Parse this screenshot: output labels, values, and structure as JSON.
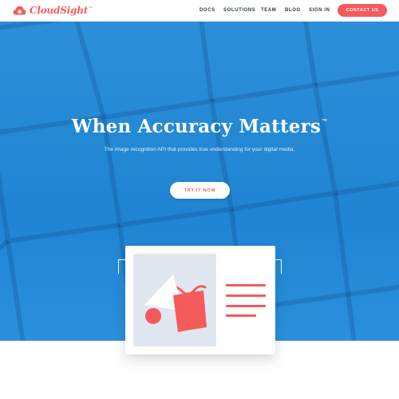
{
  "brand": {
    "name": "CloudSight",
    "trademark": "™",
    "logo_icon": "cloud-icon",
    "accent_color": "#f45b5b",
    "hero_color": "#1f85d2"
  },
  "nav": {
    "items": [
      {
        "label": "DOCS"
      },
      {
        "label": "SOLUTIONS"
      },
      {
        "label": "TEAM"
      },
      {
        "label": "BLOG"
      },
      {
        "label": "SIGN IN"
      }
    ],
    "contact_label": "CONTACT US"
  },
  "hero": {
    "title": "When Accuracy Matters",
    "title_mark": "™",
    "subtitle": "The image recognition API that provides true understanding for your digital media.",
    "cta_label": "TRY IT NOW"
  },
  "illustration": {
    "icons": [
      "corner-bracket-icon",
      "image-placeholder-icon",
      "text-lines-icon"
    ]
  }
}
